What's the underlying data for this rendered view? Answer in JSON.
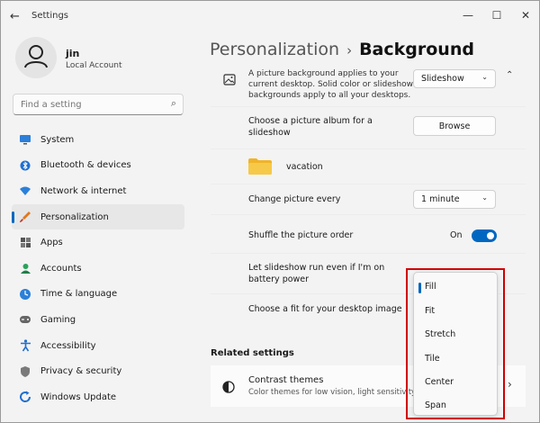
{
  "window": {
    "title": "Settings",
    "minimize": "—",
    "maximize": "☐",
    "close": "✕"
  },
  "profile": {
    "name": "jin",
    "account_type": "Local Account"
  },
  "search": {
    "placeholder": "Find a setting"
  },
  "sidebar": {
    "items": [
      {
        "label": "System",
        "icon": "monitor-icon"
      },
      {
        "label": "Bluetooth & devices",
        "icon": "bluetooth-icon"
      },
      {
        "label": "Network & internet",
        "icon": "wifi-icon"
      },
      {
        "label": "Personalization",
        "icon": "brush-icon",
        "active": true
      },
      {
        "label": "Apps",
        "icon": "apps-icon"
      },
      {
        "label": "Accounts",
        "icon": "person-icon"
      },
      {
        "label": "Time & language",
        "icon": "clock-globe-icon"
      },
      {
        "label": "Gaming",
        "icon": "gamepad-icon"
      },
      {
        "label": "Accessibility",
        "icon": "accessibility-icon"
      },
      {
        "label": "Privacy & security",
        "icon": "shield-icon"
      },
      {
        "label": "Windows Update",
        "icon": "update-icon"
      }
    ]
  },
  "header": {
    "section": "Personalization",
    "separator": "›",
    "page": "Background"
  },
  "settings": {
    "background_desc_1": "A picture background applies to your",
    "background_desc_2": "current desktop. Solid color or slideshow",
    "background_desc_3": "backgrounds apply to all your desktops.",
    "background_type": "Slideshow",
    "album_label_1": "Choose a picture album for a",
    "album_label_2": "slideshow",
    "browse_label": "Browse",
    "folder_name": "vacation",
    "change_every_label": "Change picture every",
    "change_every_value": "1 minute",
    "shuffle_label": "Shuffle the picture order",
    "shuffle_state": "On",
    "battery_label_1": "Let slideshow run even if I'm on",
    "battery_label_2": "battery power",
    "fit_label": "Choose a fit for your desktop image"
  },
  "related": {
    "heading": "Related settings",
    "contrast_title": "Contrast themes",
    "contrast_desc": "Color themes for low vision, light sensitivity"
  },
  "fit_menu": {
    "options": [
      "Fill",
      "Fit",
      "Stretch",
      "Tile",
      "Center",
      "Span"
    ],
    "selected": "Fill"
  },
  "colors": {
    "accent": "#0067c0",
    "highlight_box": "#d00000"
  }
}
